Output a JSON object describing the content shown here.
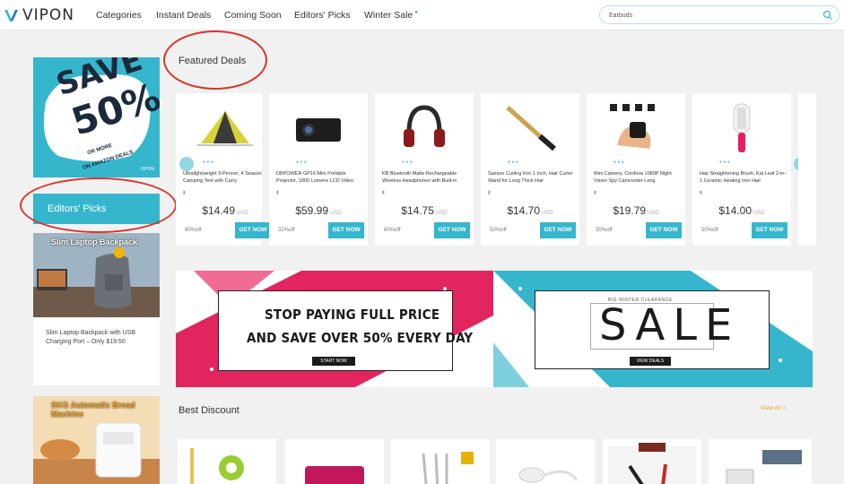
{
  "header": {
    "logo_text": "VIPON",
    "nav": [
      {
        "label": "Categories"
      },
      {
        "label": "Instant Deals"
      },
      {
        "label": "Coming Soon"
      },
      {
        "label": "Editors' Picks"
      },
      {
        "label": "Winter Sale"
      }
    ],
    "search_value": "Earbuds"
  },
  "sidebar": {
    "promo": {
      "line1": "SAVE",
      "line2": "50%",
      "line3": "OR MORE",
      "line4": "ON AMAZON DEALS",
      "brand": "VIPON"
    },
    "editors_picks_label": "Editors' Picks",
    "card1": {
      "image_title": "Slim Laptop Backpack",
      "desc": "Slim Laptop Backpack with USB Charging Port – Only $19.50"
    },
    "card2": {
      "image_title": "SKG Automatic Bread Machine"
    }
  },
  "featured": {
    "title": "Featured Deals",
    "products": [
      {
        "name": "Ultralightweight 3-Person, 4 Season Camping Tent with Carry",
        "price": "$14.49",
        "currency": "USD",
        "off": "80%off",
        "button": "GET NOW"
      },
      {
        "name": "DBPOWER GP16 Mini Portable Projector, 1800 Lumens LCD Video",
        "price": "$59.99",
        "currency": "USD",
        "off": "32%off",
        "button": "GET NOW"
      },
      {
        "name": "KB Bluetooth Matte Rechargeable Wireless Headphones with Built-in",
        "price": "$14.75",
        "currency": "USD",
        "off": "80%off",
        "button": "GET NOW"
      },
      {
        "name": "Sassoo Curling Iron 1 Inch, Hair Curler Wand for Long Thick Hair",
        "price": "$14.70",
        "currency": "USD",
        "off": "50%off",
        "button": "GET NOW"
      },
      {
        "name": "Mini Camera, Cordova 1080P Night Vision Spy Camcorder Long",
        "price": "$19.79",
        "currency": "USD",
        "off": "30%off",
        "button": "GET NOW"
      },
      {
        "name": "Hair Straightening Brush, Kat Leaf 2-in-1 Ceramic Heating Iron Hair",
        "price": "$14.00",
        "currency": "USD",
        "off": "50%off",
        "button": "GET NOW"
      }
    ]
  },
  "banners": {
    "left_line1": "STOP PAYING FULL PRICE",
    "left_line2": "AND SAVE OVER 50% EVERY DAY",
    "left_button": "START NOW",
    "right_small": "BIG WINTER CLEARANCE",
    "right_big": "SALE",
    "right_button": "VIEW DEALS"
  },
  "best_discount": {
    "title": "Best Discount",
    "view_all": "View All >"
  },
  "colors": {
    "accent": "#36b6cd",
    "pink": "#e2255f",
    "teal": "#36b6cd",
    "circle": "#d9342b"
  }
}
